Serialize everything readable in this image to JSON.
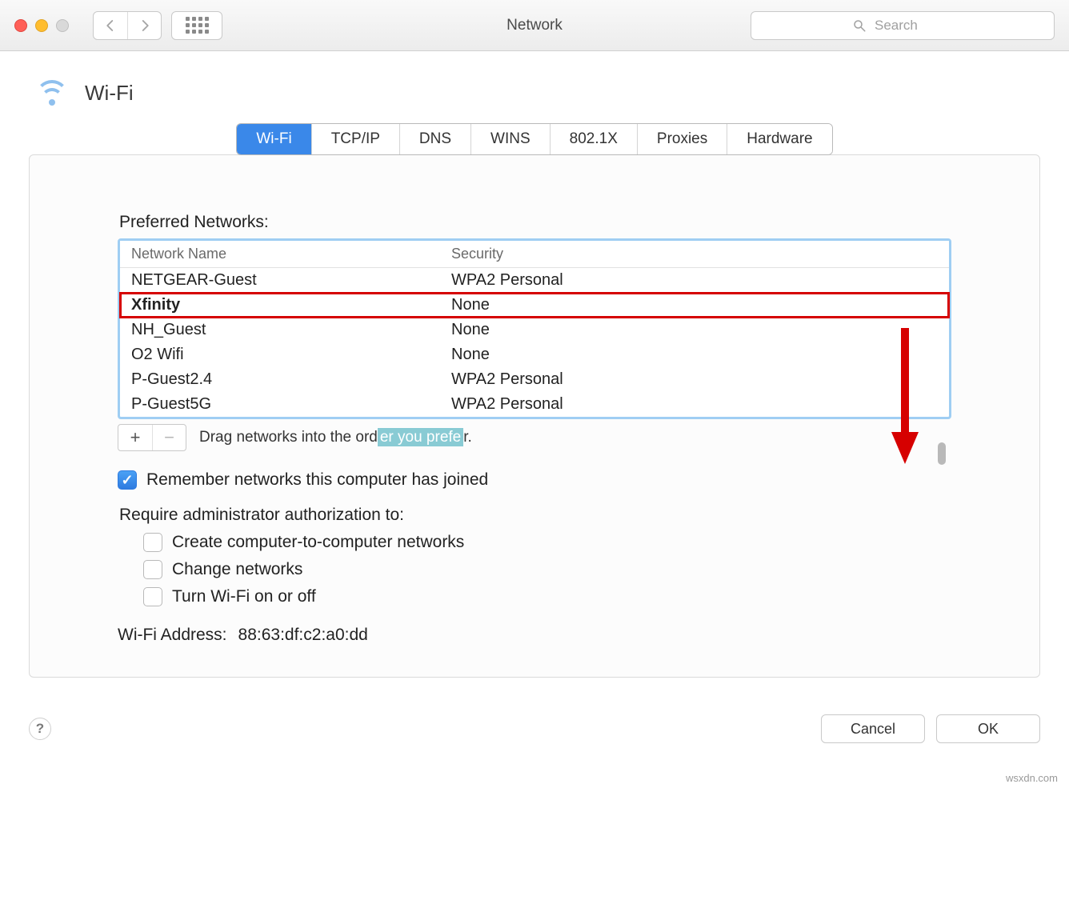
{
  "window": {
    "title": "Network",
    "search_placeholder": "Search"
  },
  "header": {
    "title": "Wi-Fi"
  },
  "tabs": [
    "Wi-Fi",
    "TCP/IP",
    "DNS",
    "WINS",
    "802.1X",
    "Proxies",
    "Hardware"
  ],
  "active_tab_index": 0,
  "preferred_label": "Preferred Networks:",
  "columns": {
    "name": "Network Name",
    "security": "Security"
  },
  "networks": [
    {
      "name": "NETGEAR-Guest",
      "security": "WPA2 Personal",
      "bold": false,
      "highlight": false
    },
    {
      "name": "Xfinity",
      "security": "None",
      "bold": true,
      "highlight": true
    },
    {
      "name": "NH_Guest",
      "security": "None",
      "bold": false,
      "highlight": false
    },
    {
      "name": "O2 Wifi",
      "security": "None",
      "bold": false,
      "highlight": false
    },
    {
      "name": "P-Guest2.4",
      "security": "WPA2 Personal",
      "bold": false,
      "highlight": false
    },
    {
      "name": "P-Guest5G",
      "security": "WPA2 Personal",
      "bold": false,
      "highlight": false
    }
  ],
  "hint": {
    "pre": "Drag networks into the ord",
    "wm": "er you prefe",
    "post": "r."
  },
  "remember": {
    "label": "Remember networks this computer has joined",
    "checked": true
  },
  "require_label": "Require administrator authorization to:",
  "require": [
    {
      "label": "Create computer-to-computer networks",
      "checked": false
    },
    {
      "label": "Change networks",
      "checked": false
    },
    {
      "label": "Turn Wi-Fi on or off",
      "checked": false
    }
  ],
  "wifi_address": {
    "label": "Wi-Fi Address:",
    "value": "88:63:df:c2:a0:dd"
  },
  "buttons": {
    "add": "+",
    "remove": "−",
    "cancel": "Cancel",
    "ok": "OK",
    "help": "?"
  },
  "attribution": "wsxdn.com"
}
